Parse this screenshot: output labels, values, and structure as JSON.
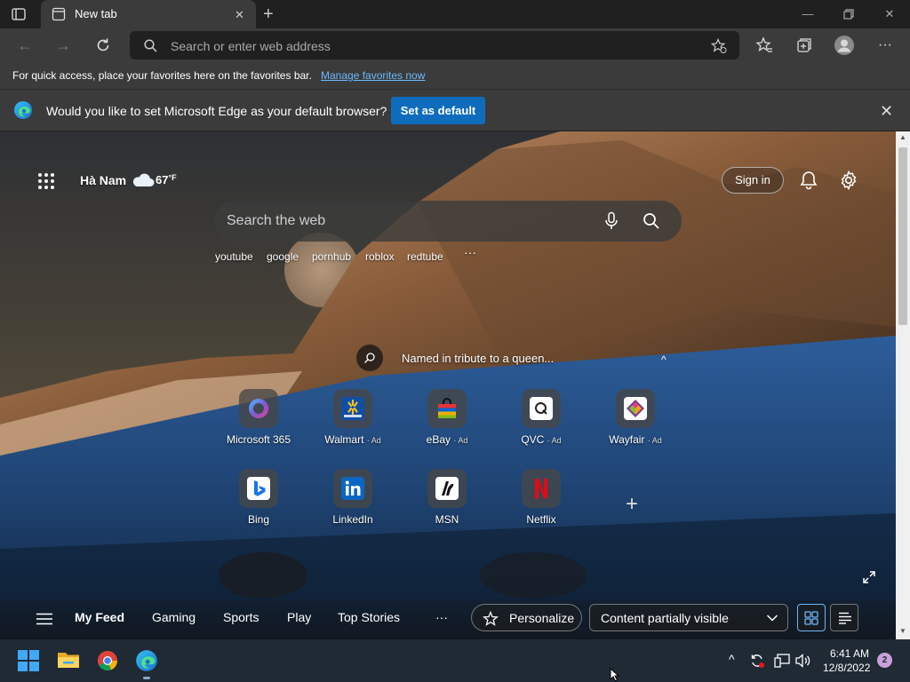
{
  "tab": {
    "title": "New tab"
  },
  "address_bar": {
    "placeholder": "Search or enter web address"
  },
  "favorites_bar": {
    "message": "For quick access, place your favorites here on the favorites bar.",
    "link": "Manage favorites now"
  },
  "infobar": {
    "message": "Would you like to set Microsoft Edge as your default browser?",
    "button": "Set as default"
  },
  "page": {
    "location": "Hà Nam",
    "temperature": "67",
    "temp_unit": "°F",
    "sign_in": "Sign in",
    "search_placeholder": "Search the web",
    "suggestions": [
      "youtube",
      "google",
      "pornhub",
      "roblox",
      "redtube"
    ],
    "caption": "Named in tribute to a queen...",
    "ad_label": "· Ad",
    "tiles": [
      {
        "label": "Microsoft 365",
        "ad": false,
        "color": "#7b5cd6"
      },
      {
        "label": "Walmart",
        "ad": true,
        "color": "#0f4ea6"
      },
      {
        "label": "eBay",
        "ad": true,
        "color": "#e53238"
      },
      {
        "label": "QVC",
        "ad": true,
        "color": "#ffffff"
      },
      {
        "label": "Wayfair",
        "ad": true,
        "color": "#7e3b8a"
      },
      {
        "label": "Bing",
        "ad": false,
        "color": "#ffffff"
      },
      {
        "label": "LinkedIn",
        "ad": false,
        "color": "#0a66c2"
      },
      {
        "label": "MSN",
        "ad": false,
        "color": "#ffffff"
      },
      {
        "label": "Netflix",
        "ad": false,
        "color": "#e50914"
      }
    ]
  },
  "feed": {
    "items": [
      "My Feed",
      "Gaming",
      "Sports",
      "Play",
      "Top Stories"
    ],
    "personalize": "Personalize",
    "visibility": "Content partially visible"
  },
  "taskbar": {
    "time": "6:41 AM",
    "date": "12/8/2022",
    "notifications": "2"
  },
  "colors": {
    "accent": "#0f6cbd",
    "link": "#6cb8ff",
    "toolbar": "#3b3b3b"
  }
}
